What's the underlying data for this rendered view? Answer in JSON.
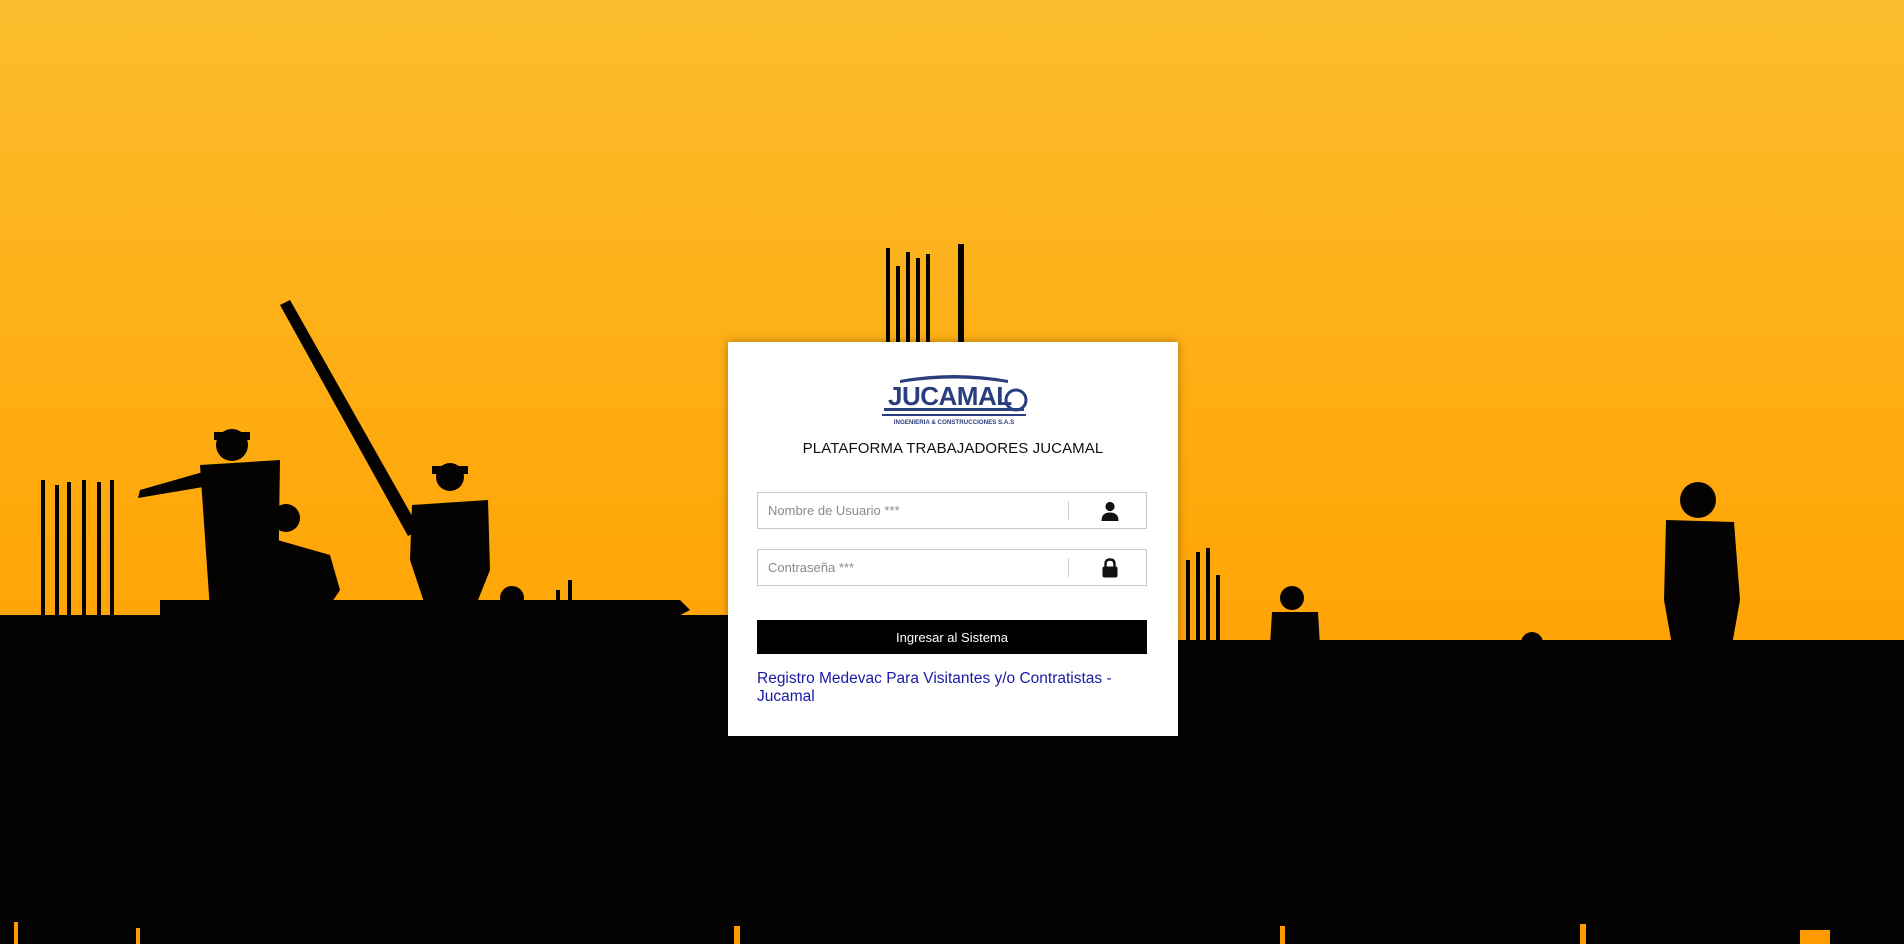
{
  "background": {
    "sky_top": "#fbbd2e",
    "sky_bottom": "#ffa000",
    "silhouette": "#050302"
  },
  "login": {
    "logo": {
      "brand": "JUCAMAL",
      "tagline": "INGENIERIA & CONSTRUCCIONES S.A.S"
    },
    "title": "PLATAFORMA TRABAJADORES JUCAMAL",
    "username": {
      "placeholder": "Nombre de Usuario ***",
      "value": "",
      "icon": "user-icon"
    },
    "password": {
      "placeholder": "Contraseña ***",
      "value": "",
      "icon": "lock-icon"
    },
    "submit_label": "Ingresar al Sistema",
    "register_link": "Registro Medevac Para Visitantes y/o Contratistas - Jucamal",
    "colors": {
      "button": "#000000",
      "link": "#1a1aa6"
    }
  }
}
